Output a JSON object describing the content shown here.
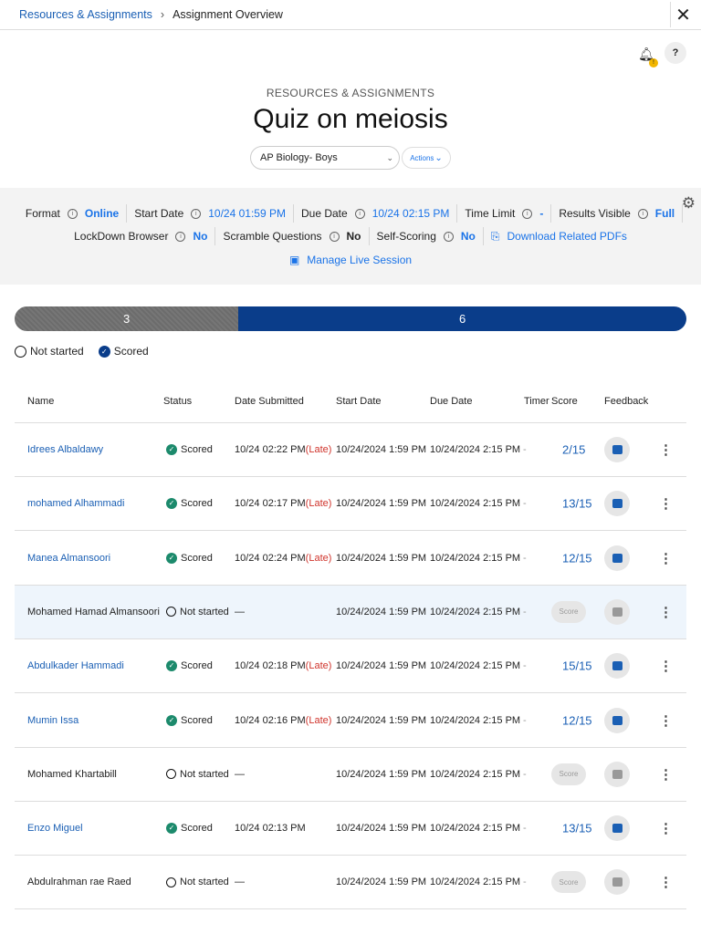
{
  "breadcrumb": {
    "parent": "Resources & Assignments",
    "current": "Assignment Overview"
  },
  "header": {
    "kicker": "RESOURCES & ASSIGNMENTS",
    "title": "Quiz on meiosis",
    "class_select": "AP Biology- Boys",
    "actions_label": "Actions",
    "notification_badge": "!",
    "help": "?"
  },
  "info": {
    "format": {
      "label": "Format",
      "value": "Online"
    },
    "start_date": {
      "label": "Start Date",
      "value": "10/24 01:59 PM"
    },
    "due_date": {
      "label": "Due Date",
      "value": "10/24 02:15 PM"
    },
    "time_limit": {
      "label": "Time Limit",
      "value": "-"
    },
    "results_visible": {
      "label": "Results Visible",
      "value": "Full"
    },
    "lockdown": {
      "label": "LockDown Browser",
      "value": "No"
    },
    "scramble": {
      "label": "Scramble Questions",
      "value": "No"
    },
    "self_scoring": {
      "label": "Self-Scoring",
      "value": "No"
    },
    "download": "Download Related PDFs",
    "manage_live": "Manage Live Session"
  },
  "progress": {
    "not_started": 3,
    "scored": 6,
    "not_started_label": "3",
    "scored_label": "6",
    "colors": {
      "not_started": "#737373",
      "scored": "#0a3d8a"
    }
  },
  "legend": {
    "not_started": "Not started",
    "scored": "Scored"
  },
  "table": {
    "headers": [
      "Name",
      "Status",
      "Date Submitted",
      "Start Date",
      "Due Date",
      "Timer",
      "Score",
      "Feedback"
    ],
    "rows": [
      {
        "name": "Idrees Albaldawy",
        "status": "Scored",
        "submitted": "10/24 02:22 PM",
        "late": "(Late)",
        "start": "10/24/2024 1:59 PM",
        "due": "10/24/2024 2:15 PM",
        "timer": "-",
        "score": "2/15"
      },
      {
        "name": "mohamed Alhammadi",
        "status": "Scored",
        "submitted": "10/24 02:17 PM",
        "late": "(Late)",
        "start": "10/24/2024 1:59 PM",
        "due": "10/24/2024 2:15 PM",
        "timer": "-",
        "score": "13/15"
      },
      {
        "name": "Manea Almansoori",
        "status": "Scored",
        "submitted": "10/24 02:24 PM",
        "late": "(Late)",
        "start": "10/24/2024 1:59 PM",
        "due": "10/24/2024 2:15 PM",
        "timer": "-",
        "score": "12/15"
      },
      {
        "name": "Mohamed Hamad Almansoori",
        "status": "Not started",
        "submitted": "—",
        "late": "",
        "start": "10/24/2024 1:59 PM",
        "due": "10/24/2024 2:15 PM",
        "timer": "-",
        "score": "Score"
      },
      {
        "name": "Abdulkader Hammadi",
        "status": "Scored",
        "submitted": "10/24 02:18 PM",
        "late": "(Late)",
        "start": "10/24/2024 1:59 PM",
        "due": "10/24/2024 2:15 PM",
        "timer": "-",
        "score": "15/15"
      },
      {
        "name": "Mumin Issa",
        "status": "Scored",
        "submitted": "10/24 02:16 PM",
        "late": "(Late)",
        "start": "10/24/2024 1:59 PM",
        "due": "10/24/2024 2:15 PM",
        "timer": "-",
        "score": "12/15"
      },
      {
        "name": "Mohamed Khartabill",
        "status": "Not started",
        "submitted": "—",
        "late": "",
        "start": "10/24/2024 1:59 PM",
        "due": "10/24/2024 2:15 PM",
        "timer": "-",
        "score": "Score"
      },
      {
        "name": "Enzo Miguel",
        "status": "Scored",
        "submitted": "10/24 02:13 PM",
        "late": "",
        "start": "10/24/2024 1:59 PM",
        "due": "10/24/2024 2:15 PM",
        "timer": "-",
        "score": "13/15"
      },
      {
        "name": "Abdulrahman rae Raed",
        "status": "Not started",
        "submitted": "—",
        "late": "",
        "start": "10/24/2024 1:59 PM",
        "due": "10/24/2024 2:15 PM",
        "timer": "-",
        "score": "Score"
      }
    ]
  }
}
